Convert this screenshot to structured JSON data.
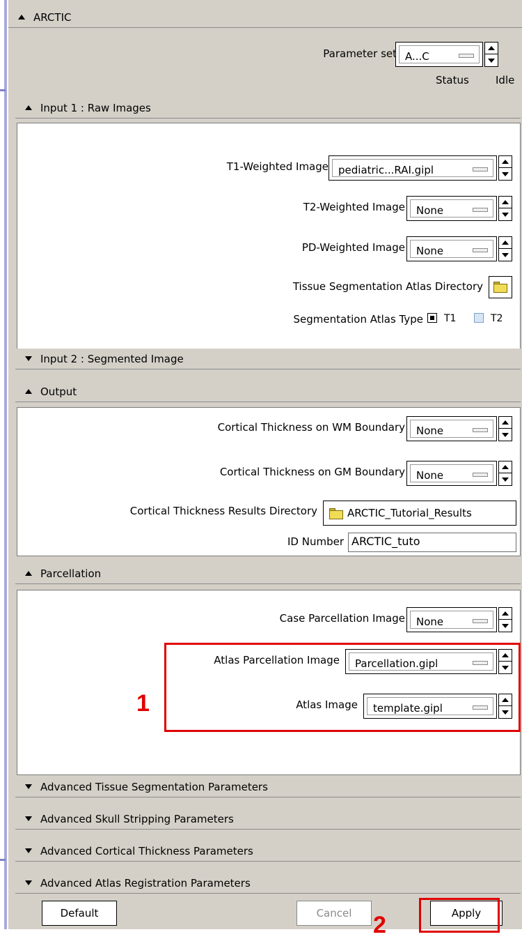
{
  "window": {
    "title": "ARCTIC"
  },
  "parameter_set": {
    "label": "Parameter set",
    "value": "A...C"
  },
  "status": {
    "label": "Status",
    "value": "Idle"
  },
  "input1": {
    "header": "Input 1 : Raw Images",
    "t1": {
      "label": "T1-Weighted Image",
      "value": "pediatric...RAI.gipl"
    },
    "t2": {
      "label": "T2-Weighted Image",
      "value": "None"
    },
    "pd": {
      "label": "PD-Weighted Image",
      "value": "None"
    },
    "atlas_dir": {
      "label": "Tissue Segmentation Atlas Directory"
    },
    "atlas_type": {
      "label": "Segmentation Atlas Type",
      "options": [
        "T1",
        "T2"
      ],
      "selected": "T1"
    }
  },
  "input2": {
    "header": "Input 2 : Segmented Image"
  },
  "output": {
    "header": "Output",
    "wm": {
      "label": "Cortical Thickness on WM Boundary",
      "value": "None"
    },
    "gm": {
      "label": "Cortical Thickness on GM Boundary",
      "value": "None"
    },
    "results_dir": {
      "label": "Cortical Thickness Results Directory",
      "value": "ARCTIC_Tutorial_Results"
    },
    "id": {
      "label": "ID Number",
      "value": "ARCTIC_tuto"
    }
  },
  "parcellation": {
    "header": "Parcellation",
    "case": {
      "label": "Case Parcellation Image",
      "value": "None"
    },
    "atlas_parc": {
      "label": "Atlas Parcellation Image",
      "value": "Parcellation.gipl"
    },
    "atlas_img": {
      "label": "Atlas Image",
      "value": "template.gipl"
    }
  },
  "advanced": [
    "Advanced Tissue Segmentation Parameters",
    "Advanced Skull Stripping Parameters",
    "Advanced Cortical Thickness Parameters",
    "Advanced Atlas Registration Parameters"
  ],
  "buttons": {
    "default": "Default",
    "cancel": "Cancel",
    "apply": "Apply"
  },
  "annotations": {
    "marker1": "1",
    "marker2": "2",
    "color": "#e00000"
  }
}
